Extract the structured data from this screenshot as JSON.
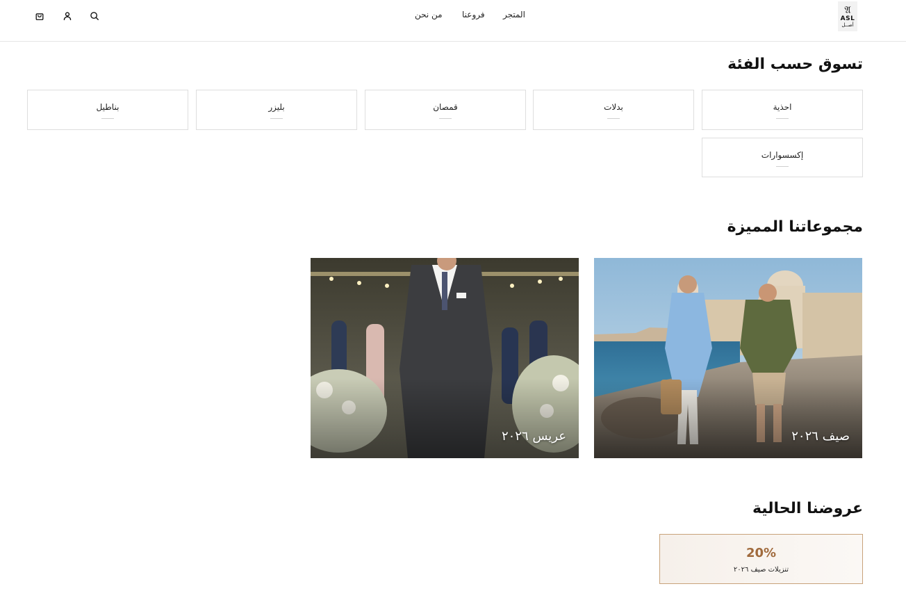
{
  "header": {
    "logo": {
      "mark": "𝔄",
      "latin": "ASL",
      "arabic": "أصــل"
    },
    "nav": {
      "store": "المتجر",
      "branches": "فروعنا",
      "about": "من نحن"
    },
    "icons": {
      "search": "search-icon",
      "account": "user-icon",
      "cart": "shopping-bag-icon"
    }
  },
  "categories": {
    "title": "تسوق حسب الفئة",
    "items": [
      "احذية",
      "بدلات",
      "قمصان",
      "بليزر",
      "بناطيل",
      "إكسسوارات"
    ]
  },
  "collections": {
    "title": "مجموعاتنا المميزة",
    "items": [
      {
        "caption": "صيف ٢٠٢٦"
      },
      {
        "caption": "عريس ٢٠٢٦"
      }
    ]
  },
  "offers": {
    "title": "عروضنا الحالية",
    "items": [
      {
        "discount": "20%",
        "label": "تنزيلات صيف ٢٠٢٦"
      }
    ]
  },
  "colors": {
    "accent": "#a06a3c",
    "offer_border": "#c8a27a",
    "divider": "#e6e6e6"
  }
}
